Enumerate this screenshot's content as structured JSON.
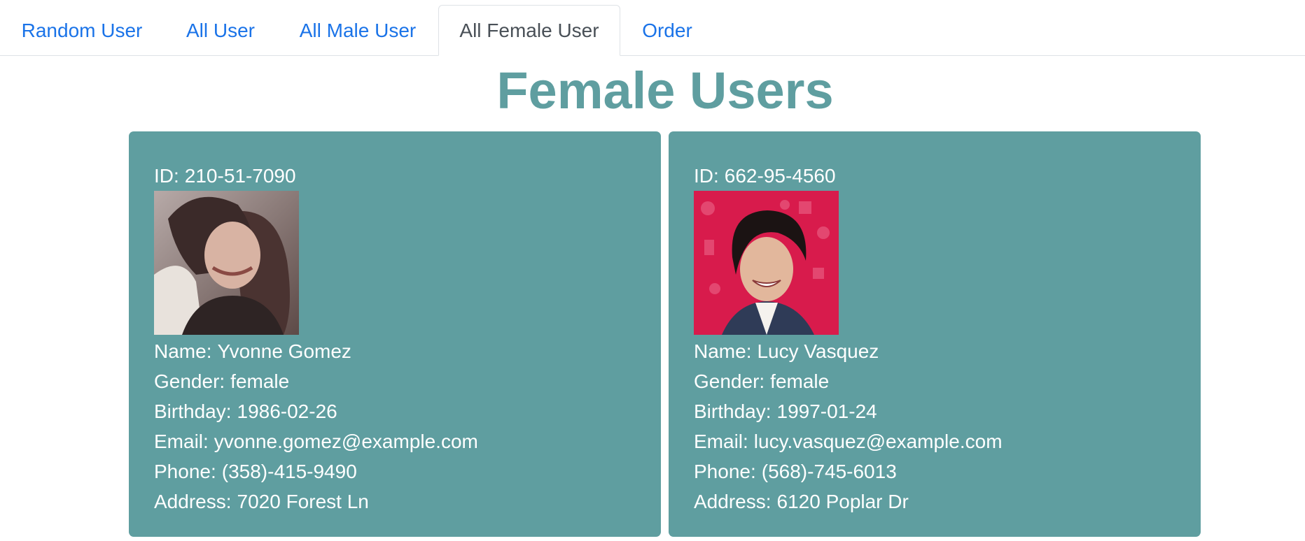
{
  "tabs": [
    {
      "label": "Random User",
      "active": false
    },
    {
      "label": "All User",
      "active": false
    },
    {
      "label": "All Male User",
      "active": false
    },
    {
      "label": "All Female User",
      "active": true
    },
    {
      "label": "Order",
      "active": false
    }
  ],
  "page": {
    "title": "Female Users"
  },
  "labels": {
    "id": "ID:",
    "name": "Name:",
    "gender": "Gender:",
    "birthday": "Birthday:",
    "email": "Email:",
    "phone": "Phone:",
    "address": "Address:"
  },
  "users": [
    {
      "id": "210-51-7090",
      "name": "Yvonne Gomez",
      "gender": "female",
      "birthday": "1986-02-26",
      "email": "yvonne.gomez@example.com",
      "phone": "(358)-415-9490",
      "address": "7020 Forest Ln"
    },
    {
      "id": "662-95-4560",
      "name": "Lucy Vasquez",
      "gender": "female",
      "birthday": "1997-01-24",
      "email": "lucy.vasquez@example.com",
      "phone": "(568)-745-6013",
      "address": "6120 Poplar Dr"
    }
  ],
  "colors": {
    "accent": "#5f9ea0",
    "link": "#1a73e8",
    "active_tab_text": "#495057"
  }
}
